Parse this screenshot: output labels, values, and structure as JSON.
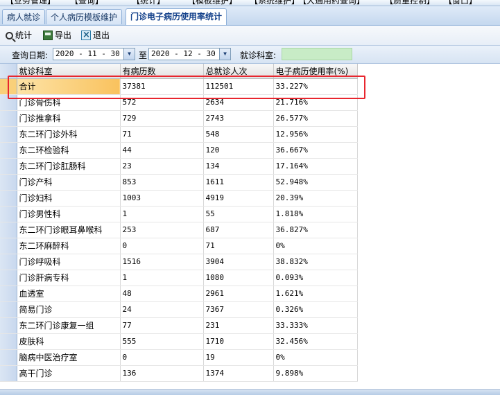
{
  "menubar": {
    "items": [
      "【业务管理】",
      "【查询】",
      "【统计】",
      "【模板维护】",
      "【系统维护】",
      "【大通用药查询】",
      "【质量控制】",
      "【窗口】"
    ]
  },
  "tabs": [
    {
      "label": "病人就诊",
      "active": false
    },
    {
      "label": "个人病历模板维护",
      "active": false
    },
    {
      "label": "门诊电子病历使用率统计",
      "active": true
    }
  ],
  "toolbar": {
    "stats_label": "统计",
    "export_label": "导出",
    "exit_label": "退出"
  },
  "filter": {
    "date_label": "查询日期:",
    "start_date": "2020 - 11 - 30",
    "to_label": "至",
    "end_date": "2020 - 12 - 30",
    "dept_label": "就诊科室:",
    "dept_value": ""
  },
  "table": {
    "columns": [
      "就诊科室",
      "有病历数",
      "总就诊人次",
      "电子病历使用率(%)"
    ],
    "rows": [
      {
        "dept": "合计",
        "records": "37381",
        "visits": "112501",
        "rate": "33.227%"
      },
      {
        "dept": "门诊骨伤科",
        "records": "572",
        "visits": "2634",
        "rate": "21.716%"
      },
      {
        "dept": "门诊推拿科",
        "records": "729",
        "visits": "2743",
        "rate": "26.577%"
      },
      {
        "dept": "东二环门诊外科",
        "records": "71",
        "visits": "548",
        "rate": "12.956%"
      },
      {
        "dept": "东二环检验科",
        "records": "44",
        "visits": "120",
        "rate": "36.667%"
      },
      {
        "dept": "东二环门诊肛肠科",
        "records": "23",
        "visits": "134",
        "rate": "17.164%"
      },
      {
        "dept": "门诊产科",
        "records": "853",
        "visits": "1611",
        "rate": "52.948%"
      },
      {
        "dept": "门诊妇科",
        "records": "1003",
        "visits": "4919",
        "rate": "20.39%"
      },
      {
        "dept": "门诊男性科",
        "records": "1",
        "visits": "55",
        "rate": "1.818%"
      },
      {
        "dept": "东二环门诊眼耳鼻喉科",
        "records": "253",
        "visits": "687",
        "rate": "36.827%"
      },
      {
        "dept": "东二环麻醉科",
        "records": "0",
        "visits": "71",
        "rate": "0%"
      },
      {
        "dept": "门诊呼吸科",
        "records": "1516",
        "visits": "3904",
        "rate": "38.832%"
      },
      {
        "dept": "门诊肝病专科",
        "records": "1",
        "visits": "1080",
        "rate": "0.093%"
      },
      {
        "dept": "血透室",
        "records": "48",
        "visits": "2961",
        "rate": "1.621%"
      },
      {
        "dept": "简易门诊",
        "records": "24",
        "visits": "7367",
        "rate": "0.326%"
      },
      {
        "dept": "东二环门诊康复一组",
        "records": "77",
        "visits": "231",
        "rate": "33.333%"
      },
      {
        "dept": "皮肤科",
        "records": "555",
        "visits": "1710",
        "rate": "32.456%"
      },
      {
        "dept": "脑病中医治疗室",
        "records": "0",
        "visits": "19",
        "rate": "0%"
      },
      {
        "dept": "高干门诊",
        "records": "136",
        "visits": "1374",
        "rate": "9.898%"
      }
    ]
  },
  "colors": {
    "highlight_border": "#e8262e",
    "total_row": "#f9c25e",
    "dept_box": "#c8ecc6"
  }
}
